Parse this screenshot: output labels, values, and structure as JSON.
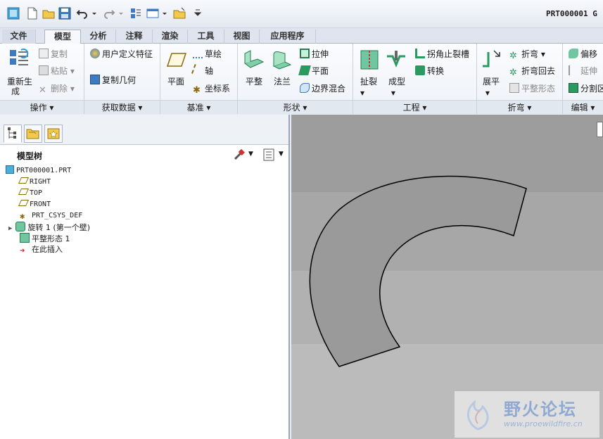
{
  "window": {
    "title": "PRT000001  G"
  },
  "tabs": [
    "文件",
    "模型",
    "分析",
    "注释",
    "渲染",
    "工具",
    "视图",
    "应用程序"
  ],
  "ribbon": {
    "operations": {
      "regenerate": "重新生",
      "regenerate2": "成",
      "copy": "复制",
      "paste": "粘贴",
      "delete": "删除",
      "label": "操作"
    },
    "get_data": {
      "udf": "用户定义特征",
      "copy_geom": "复制几何",
      "label": "获取数据"
    },
    "datum": {
      "plane": "平面",
      "sketch": "草绘",
      "axis": "轴",
      "csys": "坐标系",
      "label": "基准"
    },
    "shapes": {
      "flat": "平整",
      "flange": "法兰",
      "extrude": "拉伸",
      "plane": "平面",
      "boundary_blend": "边界混合",
      "label": "形状"
    },
    "engineering": {
      "rip": "扯裂",
      "form": "成型",
      "corner_relief": "拐角止裂槽",
      "convert": "转换",
      "label": "工程"
    },
    "bend": {
      "unbend": "展平",
      "bend": "折弯",
      "bend_back": "折弯回去",
      "flat_pattern": "平整形态",
      "label": "折弯"
    },
    "edit": {
      "offset": "偏移",
      "extend": "延伸",
      "split": "分割区",
      "label": "编辑"
    }
  },
  "model_tree": {
    "title": "模型树",
    "items": [
      "PRT000001.PRT",
      "RIGHT",
      "TOP",
      "FRONT",
      "PRT_CSYS_DEF",
      "旋转 1 (第一个壁)",
      "平整形态 1",
      "在此插入"
    ]
  },
  "watermark": {
    "name": "野火论坛",
    "url": "www.proewildfire.cn"
  },
  "colors": {
    "part_fill": "#9a9a9a",
    "viewport_bg": "#b4b4b4",
    "accent": "#2b6cb0"
  }
}
